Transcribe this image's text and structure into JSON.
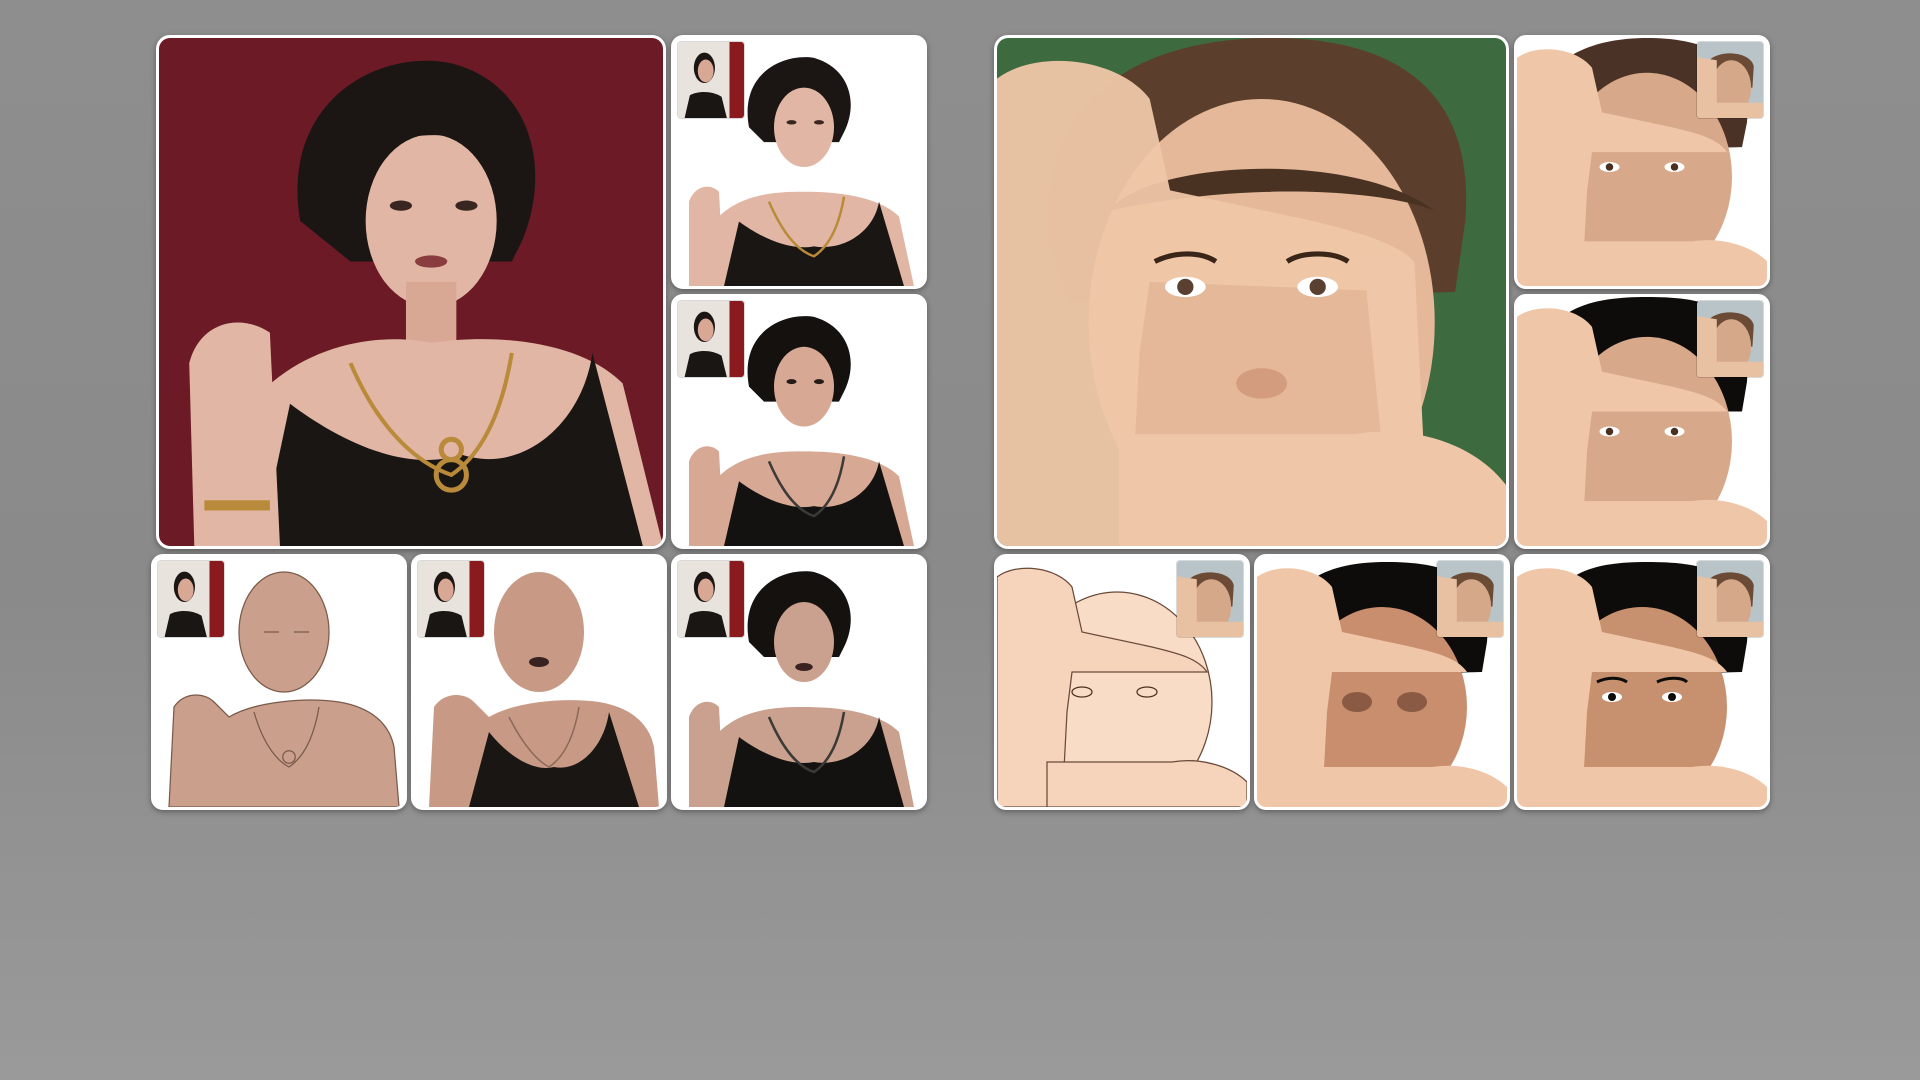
{
  "gallery": {
    "background_top": "#8e8e8e",
    "background_bottom": "#9a9a9a",
    "tile_border": "#ffffff"
  },
  "woman_set": {
    "background_main": "#6b1a26",
    "skin": "#e2b6a4",
    "top": "#1a1614",
    "hair": "#1b1614",
    "necklace": "#b88a3a",
    "panels": [
      {
        "name": "final-portrait",
        "stage": "final"
      },
      {
        "name": "process-final",
        "stage": "final"
      },
      {
        "name": "process-dark-details",
        "stage": "details"
      },
      {
        "name": "process-lineart",
        "stage": "lineart"
      },
      {
        "name": "process-flat-colors",
        "stage": "flat"
      },
      {
        "name": "process-shading",
        "stage": "shading"
      }
    ]
  },
  "man_set": {
    "background_main": "#3d6a3f",
    "skin": "#efc7a8",
    "hair": "#5b3f2c",
    "panels": [
      {
        "name": "final-portrait",
        "stage": "final"
      },
      {
        "name": "process-refined",
        "stage": "refined"
      },
      {
        "name": "process-hair-black",
        "stage": "hair"
      },
      {
        "name": "process-lineart",
        "stage": "lineart"
      },
      {
        "name": "process-base-colors",
        "stage": "base"
      },
      {
        "name": "process-eyes-detail",
        "stage": "eyes"
      }
    ]
  }
}
